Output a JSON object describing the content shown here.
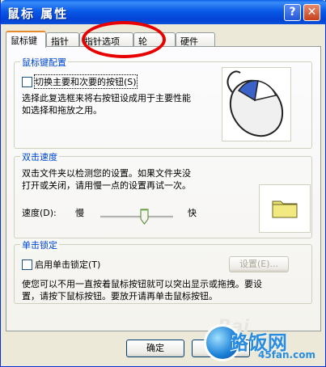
{
  "window": {
    "title": "鼠标 属性",
    "help_glyph": "?",
    "close_glyph": "✕"
  },
  "tabs": [
    {
      "label": "鼠标键",
      "active": true
    },
    {
      "label": "指针"
    },
    {
      "label": "指针选项"
    },
    {
      "label": "轮"
    },
    {
      "label": "硬件"
    }
  ],
  "buttons_config": {
    "legend": "鼠标键配置",
    "checkbox_label": "切换主要和次要的按钮(S)",
    "checked": false,
    "description_1": "选择此复选框来将右按钮设成用于主要性能",
    "description_2": "如选择和拖放之用。",
    "image_icon": "mouse-icon"
  },
  "double_click": {
    "legend": "双击速度",
    "description_1": "双击文件夹以检测您的设置。如果文件夹没",
    "description_2": "打开或关闭，请用慢一点的设置再试一次。",
    "speed_label": "速度(D):",
    "slow_label": "慢",
    "fast_label": "快",
    "speed_value": 0.6,
    "image_icon": "folder-icon"
  },
  "click_lock": {
    "legend": "单击锁定",
    "checkbox_label": "启用单击锁定(T)",
    "checked": false,
    "settings_label": "设置(E)...",
    "description_1": "使您可以不用一直按着鼠标按钮就可以突出显示或拖拽。要设",
    "description_2": "置，请按下鼠标按钮。要放开请再单击鼠标按钮。"
  },
  "footer": {
    "ok_label": "确定"
  },
  "watermark": {
    "baidu": "Bai",
    "site": "路饭网",
    "url": "45fan.com"
  },
  "colors": {
    "title_bar": "#0a5ae8",
    "legend_text": "#0046d5",
    "annotation": "#e80000",
    "watermark": "#2a8de0"
  }
}
